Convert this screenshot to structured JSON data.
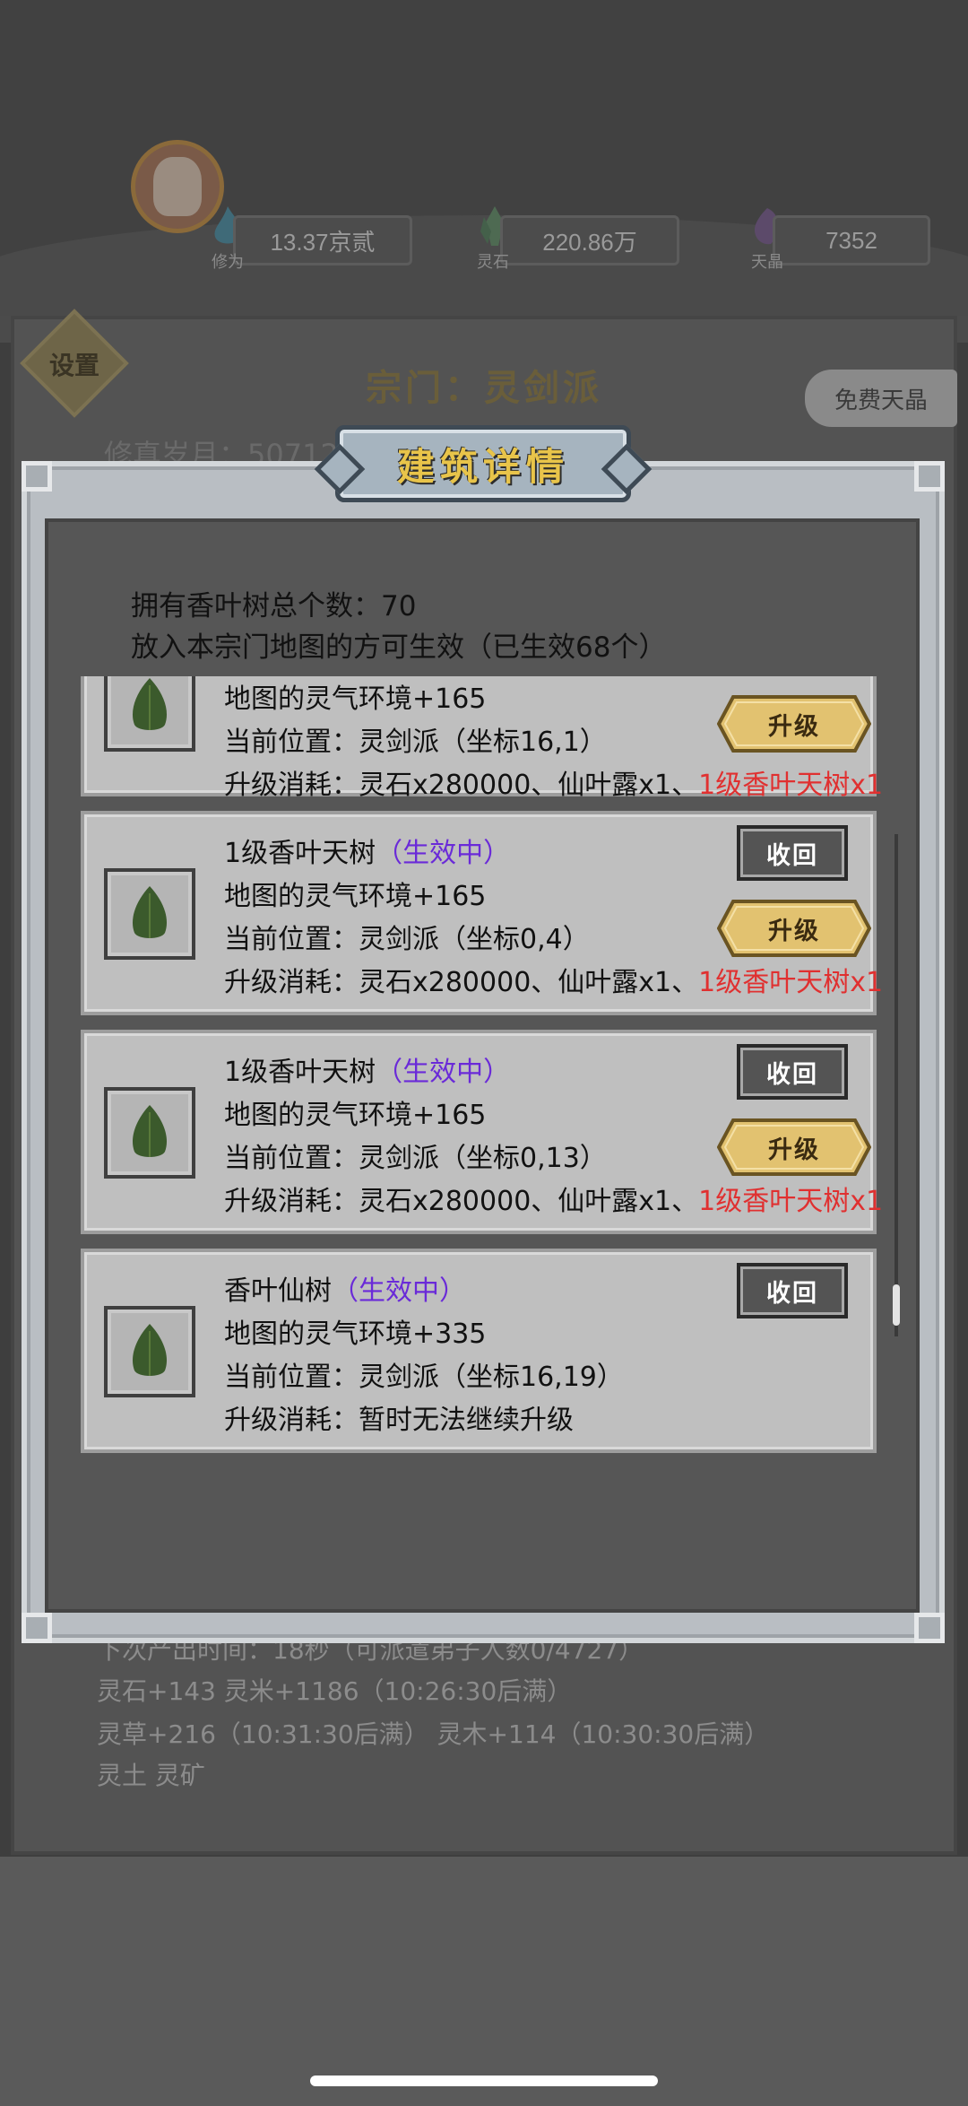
{
  "header": {
    "resources": [
      {
        "label": "修为",
        "value": "13.37京贰"
      },
      {
        "label": "灵石",
        "value": "220.86万"
      },
      {
        "label": "天晶",
        "value": "7352"
      }
    ]
  },
  "settings_label": "设置",
  "sect_title": "宗门：灵剑派",
  "free_button": "免费天晶",
  "days_text": "修真岁月：50712",
  "background_lines": [
    "下次产出时间：18秒（可派遣弟子人数0/4727）",
    "灵石+143        灵米+1186（10:26:30后满）",
    "灵草+216（10:31:30后满）        灵木+114（10:30:30后满）",
    "灵土        灵矿"
  ],
  "modal": {
    "title": "建筑详情",
    "total_line": "拥有香叶树总个数：70",
    "effect_line": "放入本宗门地图的方可生效（已生效68个）",
    "recall_label": "收回",
    "upgrade_label": "升级",
    "cards": [
      {
        "name": "",
        "status": "",
        "env": "地图的灵气环境+165",
        "location": "当前位置：灵剑派（坐标16,1）",
        "cost": "升级消耗：灵石x280000、仙叶露x1、",
        "cost_extra": "1级香叶天树x1"
      },
      {
        "name": "1级香叶天树",
        "status": "（生效中）",
        "env": "地图的灵气环境+165",
        "location": "当前位置：灵剑派（坐标0,4）",
        "cost": "升级消耗：灵石x280000、仙叶露x1、",
        "cost_extra": "1级香叶天树x1"
      },
      {
        "name": "1级香叶天树",
        "status": "（生效中）",
        "env": "地图的灵气环境+165",
        "location": "当前位置：灵剑派（坐标0,13）",
        "cost": "升级消耗：灵石x280000、仙叶露x1、",
        "cost_extra": "1级香叶天树x1"
      },
      {
        "name": "香叶仙树",
        "status": "（生效中）",
        "env": "地图的灵气环境+335",
        "location": "当前位置：灵剑派（坐标16,19）",
        "cost": "升级消耗：暂时无法继续升级",
        "cost_extra": ""
      }
    ]
  }
}
